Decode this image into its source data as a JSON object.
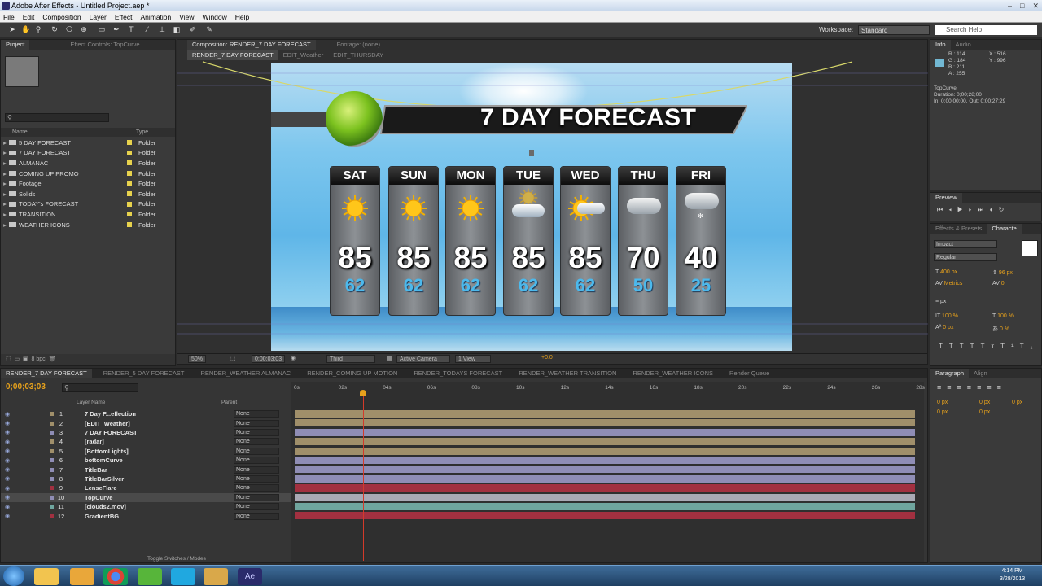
{
  "window": {
    "title": "Adobe After Effects - Untitled Project.aep *",
    "controls": [
      "–",
      "□",
      "✕"
    ]
  },
  "menu": [
    "File",
    "Edit",
    "Composition",
    "Layer",
    "Effect",
    "Animation",
    "View",
    "Window",
    "Help"
  ],
  "toolbar": {
    "workspace_label": "Workspace:",
    "workspace_value": "Standard",
    "search_placeholder": "Search Help"
  },
  "project": {
    "tabs": [
      "Project",
      "Effect Controls: TopCurve"
    ],
    "columns": {
      "name": "Name",
      "type": "Type"
    },
    "items": [
      {
        "name": "5 DAY FORECAST",
        "type": "Folder"
      },
      {
        "name": "7 DAY FORECAST",
        "type": "Folder"
      },
      {
        "name": "ALMANAC",
        "type": "Folder"
      },
      {
        "name": "COMING UP PROMO",
        "type": "Folder"
      },
      {
        "name": "Footage",
        "type": "Folder"
      },
      {
        "name": "Solids",
        "type": "Folder"
      },
      {
        "name": "TODAY's FORECAST",
        "type": "Folder"
      },
      {
        "name": "TRANSITION",
        "type": "Folder"
      },
      {
        "name": "WEATHER ICONS",
        "type": "Folder"
      }
    ],
    "bpc": "8 bpc"
  },
  "comp_viewer": {
    "tab": "Composition: RENDER_7 DAY FORECAST",
    "footage_tab": "Footage: (none)",
    "breadcrumbs": [
      "RENDER_7 DAY FORECAST",
      "EDIT_Weather",
      "EDIT_THURSDAY"
    ],
    "zoom": "50%",
    "timecode": "0;00;03;03",
    "resolution": "Third",
    "camera": "Active Camera",
    "views": "1 View",
    "exposure": "+0.0"
  },
  "forecast": {
    "title": "7 DAY FORECAST",
    "days": [
      {
        "day": "SAT",
        "high": "85",
        "low": "62",
        "icon": "sun-icon"
      },
      {
        "day": "SUN",
        "high": "85",
        "low": "62",
        "icon": "sun-icon"
      },
      {
        "day": "MON",
        "high": "85",
        "low": "62",
        "icon": "sun-icon"
      },
      {
        "day": "TUE",
        "high": "85",
        "low": "62",
        "icon": "cloud-sun-icon"
      },
      {
        "day": "WED",
        "high": "85",
        "low": "62",
        "icon": "sun-cloud-icon"
      },
      {
        "day": "THU",
        "high": "70",
        "low": "50",
        "icon": "cloud-icon"
      },
      {
        "day": "FRI",
        "high": "40",
        "low": "25",
        "icon": "snow-cloud-icon"
      }
    ]
  },
  "info": {
    "tabs": [
      "Info",
      "Audio"
    ],
    "r": "R : 114",
    "g": "G : 184",
    "b": "B : 211",
    "a": "A : 255",
    "x": "X : 516",
    "y": "Y : 996",
    "layer": "TopCurve",
    "duration": "Duration: 0;00;28;00",
    "inout": "In: 0;00;00;00, Out: 0;00;27;29"
  },
  "preview": {
    "tab": "Preview"
  },
  "character": {
    "tabs": [
      "Effects & Presets",
      "Characte"
    ],
    "font": "Impact",
    "style": "Regular",
    "size": "400 px",
    "leading": "96 px",
    "tracking": "Metrics",
    "kern": "0",
    "stroke_unit": "px",
    "vscale": "100 %",
    "hscale": "100 %",
    "baseline": "0 px",
    "tsume": "0 %"
  },
  "paragraph": {
    "tabs": [
      "Paragraph",
      "Align"
    ],
    "indent_unit": "0 px",
    "space_unit": "0 px"
  },
  "timeline": {
    "tabs": [
      "RENDER_7 DAY FORECAST",
      "RENDER_5 DAY FORECAST",
      "RENDER_WEATHER ALMANAC",
      "RENDER_COMING UP MOTION",
      "RENDER_TODAYS FORECAST",
      "RENDER_WEATHER TRANSITION",
      "RENDER_WEATHER ICONS",
      "Render Queue"
    ],
    "timecode": "0;00;03;03",
    "columns": {
      "layer_name": "Layer Name",
      "parent": "Parent"
    },
    "ruler": [
      "0s",
      "02s",
      "04s",
      "06s",
      "08s",
      "10s",
      "12s",
      "14s",
      "16s",
      "18s",
      "20s",
      "22s",
      "24s",
      "26s",
      "28s"
    ],
    "layers": [
      {
        "num": "1",
        "name": "7 Day F...eflection",
        "parent": "None",
        "bar": "#a08f6a",
        "swatch": "#a08f6a"
      },
      {
        "num": "2",
        "name": "[EDIT_Weather]",
        "parent": "None",
        "bar": "#a08f6a",
        "swatch": "#a08f6a"
      },
      {
        "num": "3",
        "name": "7 DAY FORECAST",
        "parent": "None",
        "bar": "#8f8db5",
        "swatch": "#8f8db5"
      },
      {
        "num": "4",
        "name": "[radar]",
        "parent": "None",
        "bar": "#a08f6a",
        "swatch": "#a08f6a"
      },
      {
        "num": "5",
        "name": "[BottomLights]",
        "parent": "None",
        "bar": "#a08f6a",
        "swatch": "#a08f6a"
      },
      {
        "num": "6",
        "name": "bottomCurve",
        "parent": "None",
        "bar": "#8f8db5",
        "swatch": "#8f8db5"
      },
      {
        "num": "7",
        "name": "TitleBar",
        "parent": "None",
        "bar": "#8f8db5",
        "swatch": "#8f8db5"
      },
      {
        "num": "8",
        "name": "TitleBarSilver",
        "parent": "None",
        "bar": "#8f8db5",
        "swatch": "#8f8db5"
      },
      {
        "num": "9",
        "name": "LenseFlare",
        "parent": "None",
        "bar": "#a23040",
        "swatch": "#a23040"
      },
      {
        "num": "10",
        "name": "TopCurve",
        "parent": "None",
        "bar": "#a9a9b4",
        "swatch": "#8f8db5"
      },
      {
        "num": "11",
        "name": "[clouds2.mov]",
        "parent": "None",
        "bar": "#6fa59e",
        "swatch": "#6fa59e"
      },
      {
        "num": "12",
        "name": "GradientBG",
        "parent": "None",
        "bar": "#a23040",
        "swatch": "#a23040"
      }
    ],
    "toggle_label": "Toggle Switches / Modes"
  },
  "taskbar": {
    "time": "4:14 PM",
    "date": "3/28/2013"
  },
  "colors": {
    "accent": "#e6a11c",
    "panel": "#3a3a3a",
    "playhead": "#d43a2a"
  }
}
